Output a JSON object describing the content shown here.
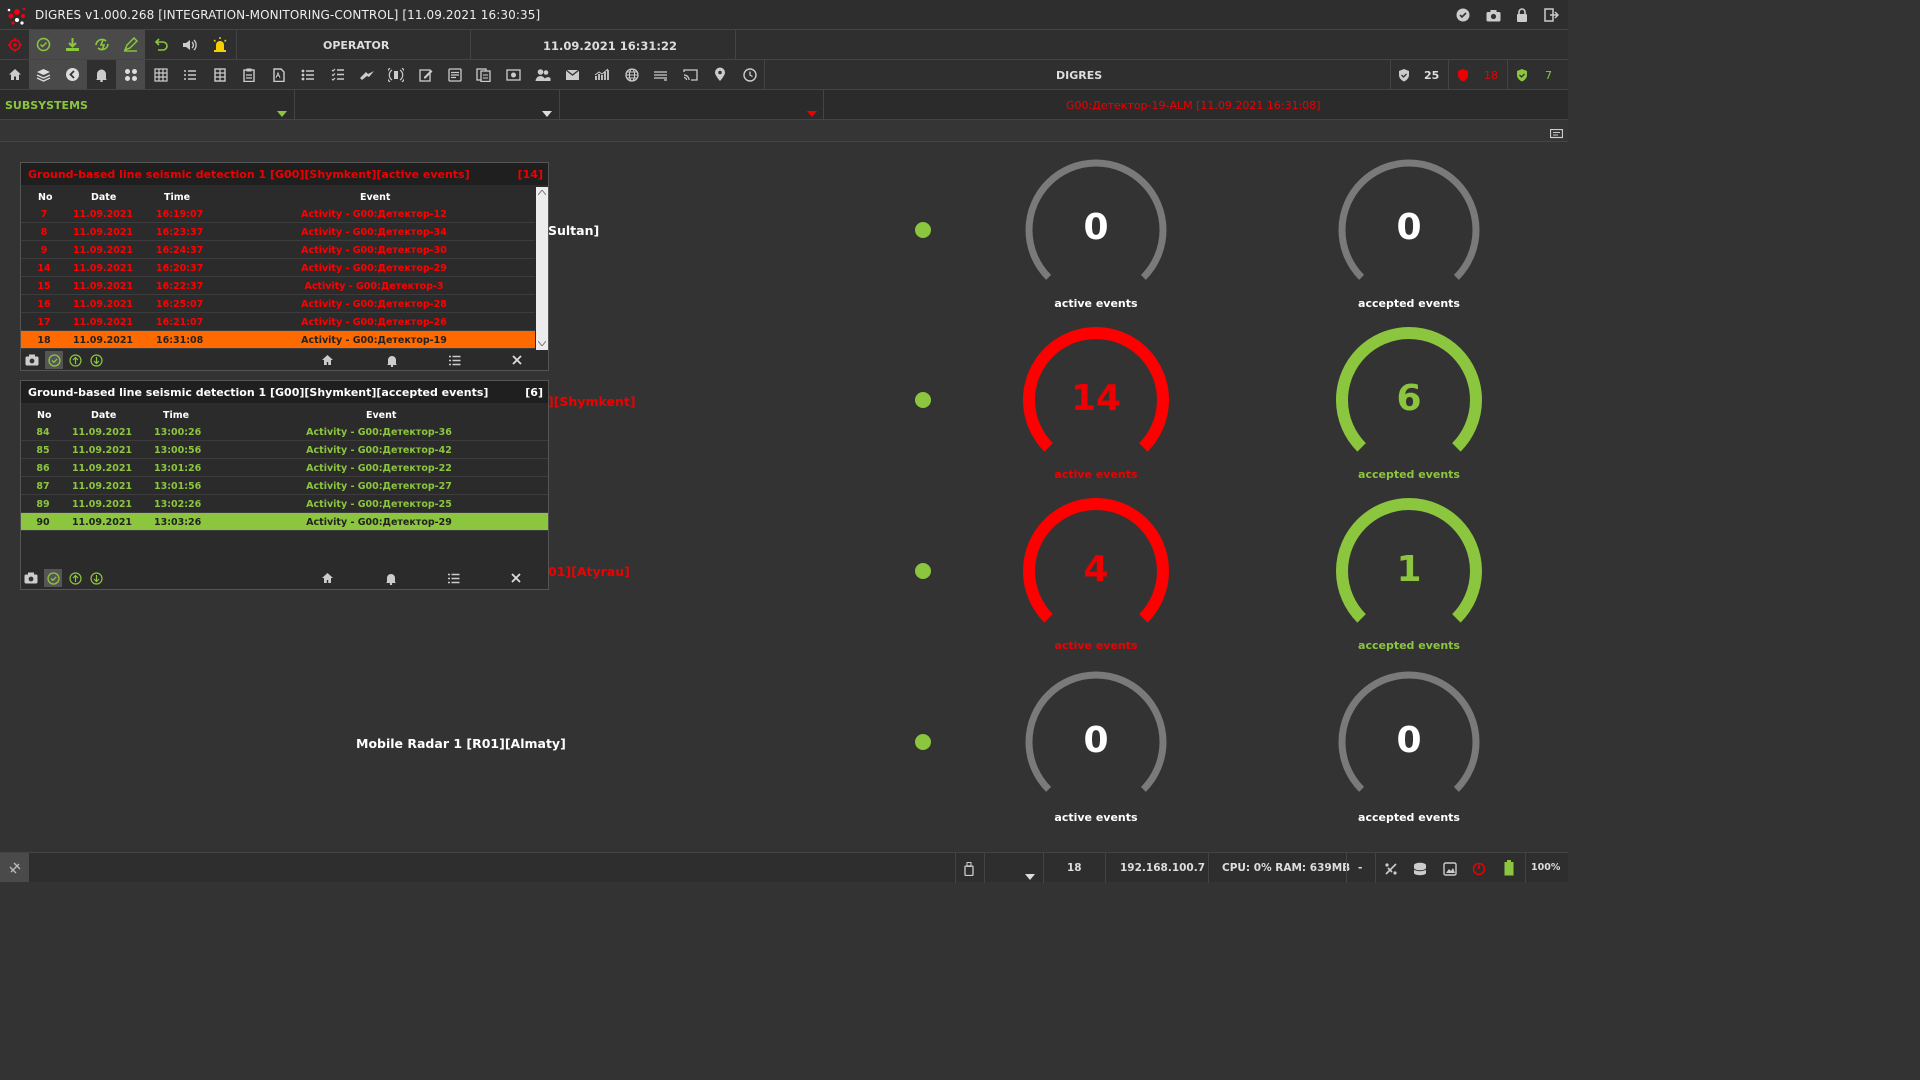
{
  "titlebar": {
    "title": "DIGRES v1.000.268 [INTEGRATION-MONITORING-CONTROL] [11.09.2021 16:30:35]"
  },
  "toolbar": {
    "role": "OPERATOR",
    "datetime": "11.09.2021 16:31:22",
    "app_name": "DIGRES",
    "counters": {
      "total": "25",
      "alarms": "18",
      "ok": "7"
    }
  },
  "filterbar": {
    "subsystems_label": "SUBSYSTEMS",
    "alarm_text": "G00:Детектор-19-ALM [11.09.2021 16:31:08]"
  },
  "colors": {
    "accent_green": "#8cc63f",
    "alarm_red": "#ff0000",
    "orange": "#ff6a00",
    "gray_arc": "#7a7a7a"
  },
  "rows": [
    {
      "label": "Sultan]",
      "active": "0",
      "accepted": "0",
      "active_caption": "active events",
      "accepted_caption": "accepted events"
    },
    {
      "label": "][Shymkent]",
      "active": "14",
      "accepted": "6",
      "active_caption": "active events",
      "accepted_caption": "accepted events"
    },
    {
      "label": "01][Atyrau]",
      "active": "4",
      "accepted": "1",
      "active_caption": "active events",
      "accepted_caption": "accepted events"
    },
    {
      "label": "Mobile Radar 1 [R01][Almaty]",
      "active": "0",
      "accepted": "0",
      "active_caption": "active events",
      "accepted_caption": "accepted events"
    }
  ],
  "active_panel": {
    "title": "Ground-based line seismic detection 1 [G00][Shymkent][active events]",
    "count": "[14]",
    "columns": [
      "No",
      "Date",
      "Time",
      "Event"
    ],
    "rows": [
      {
        "no": "7",
        "date": "11.09.2021",
        "time": "16:19:07",
        "event": "Activity - G00:Детектор-12"
      },
      {
        "no": "8",
        "date": "11.09.2021",
        "time": "16:23:37",
        "event": "Activity - G00:Детектор-34"
      },
      {
        "no": "9",
        "date": "11.09.2021",
        "time": "16:24:37",
        "event": "Activity - G00:Детектор-30"
      },
      {
        "no": "14",
        "date": "11.09.2021",
        "time": "16:20:37",
        "event": "Activity - G00:Детектор-29"
      },
      {
        "no": "15",
        "date": "11.09.2021",
        "time": "16:22:37",
        "event": "Activity - G00:Детектор-3"
      },
      {
        "no": "16",
        "date": "11.09.2021",
        "time": "16:25:07",
        "event": "Activity - G00:Детектор-28"
      },
      {
        "no": "17",
        "date": "11.09.2021",
        "time": "16:21:07",
        "event": "Activity - G00:Детектор-26"
      },
      {
        "no": "18",
        "date": "11.09.2021",
        "time": "16:31:08",
        "event": "Activity - G00:Детектор-19"
      }
    ]
  },
  "accepted_panel": {
    "title": "Ground-based line seismic detection 1 [G00][Shymkent][accepted events]",
    "count": "[6]",
    "columns": [
      "No",
      "Date",
      "Time",
      "Event"
    ],
    "rows": [
      {
        "no": "84",
        "date": "11.09.2021",
        "time": "13:00:26",
        "event": "Activity - G00:Детектор-36"
      },
      {
        "no": "85",
        "date": "11.09.2021",
        "time": "13:00:56",
        "event": "Activity - G00:Детектор-42"
      },
      {
        "no": "86",
        "date": "11.09.2021",
        "time": "13:01:26",
        "event": "Activity - G00:Детектор-22"
      },
      {
        "no": "87",
        "date": "11.09.2021",
        "time": "13:01:56",
        "event": "Activity - G00:Детектор-27"
      },
      {
        "no": "89",
        "date": "11.09.2021",
        "time": "13:02:26",
        "event": "Activity - G00:Детектор-25"
      },
      {
        "no": "90",
        "date": "11.09.2021",
        "time": "13:03:26",
        "event": "Activity - G00:Детектор-29"
      }
    ]
  },
  "statusbar": {
    "count": "18",
    "ip": "192.168.100.7",
    "resources": "CPU: 0% RAM: 639MB",
    "dash": "-",
    "zoom": "100%"
  }
}
